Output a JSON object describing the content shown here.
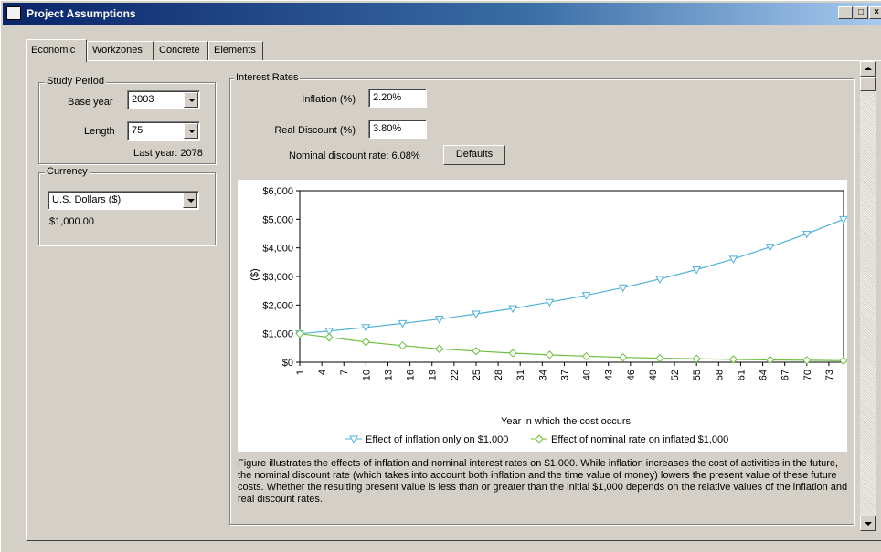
{
  "window": {
    "title": "Project Assumptions",
    "minimize_label": "_",
    "maximize_label": "□",
    "close_label": "×"
  },
  "tabs": [
    {
      "label": "Economic",
      "active": true
    },
    {
      "label": "Workzones",
      "active": false
    },
    {
      "label": "Concrete",
      "active": false
    },
    {
      "label": "Elements",
      "active": false
    }
  ],
  "study_period": {
    "title": "Study Period",
    "base_year_label": "Base year",
    "base_year_value": "2003",
    "length_label": "Length",
    "length_value": "75",
    "last_year_text": "Last year: 2078"
  },
  "currency": {
    "title": "Currency",
    "selected": "U.S. Dollars ($)",
    "amount": "$1,000.00"
  },
  "interest_rates": {
    "title": "Interest Rates",
    "inflation_label": "Inflation (%)",
    "inflation_value": "2.20%",
    "real_discount_label": "Real Discount (%)",
    "real_discount_value": "3.80%",
    "nominal_text": "Nominal discount rate: 6.08%",
    "defaults_label": "Defaults"
  },
  "chart_data": {
    "type": "line",
    "xlabel": "Year in which the cost occurs",
    "ylabel": "($)",
    "ylim": [
      0,
      6000
    ],
    "yticks": [
      "$0",
      "$1,000",
      "$2,000",
      "$3,000",
      "$4,000",
      "$5,000",
      "$6,000"
    ],
    "xticks": [
      "1",
      "4",
      "7",
      "10",
      "13",
      "16",
      "19",
      "22",
      "25",
      "28",
      "31",
      "34",
      "37",
      "40",
      "43",
      "46",
      "49",
      "52",
      "55",
      "58",
      "61",
      "64",
      "67",
      "70",
      "73"
    ],
    "grid": false,
    "legend": "bottom",
    "x": [
      1,
      5,
      10,
      15,
      20,
      25,
      30,
      35,
      40,
      45,
      50,
      55,
      60,
      65,
      70,
      75
    ],
    "series": [
      {
        "name": "Effect of inflation only on $1,000",
        "color": "#4fb3d9",
        "marker": "triangle-down",
        "values": [
          1000,
          1090,
          1220,
          1360,
          1510,
          1690,
          1880,
          2100,
          2340,
          2610,
          2910,
          3240,
          3610,
          4030,
          4490,
          5000
        ]
      },
      {
        "name": "Effect of nominal rate on inflated $1,000",
        "color": "#6cbf3f",
        "marker": "diamond",
        "values": [
          1000,
          870,
          710,
          580,
          470,
          390,
          320,
          260,
          210,
          170,
          140,
          120,
          100,
          80,
          70,
          55
        ]
      }
    ]
  },
  "description": "Figure illustrates the effects of inflation and nominal interest rates on $1,000. While inflation increases the cost of activities in the future, the nominal discount rate (which takes into account both inflation and the time value of money) lowers the present value of these future costs. Whether the resulting present value is less than or greater than the initial $1,000 depends on the relative values of the inflation and real discount rates."
}
